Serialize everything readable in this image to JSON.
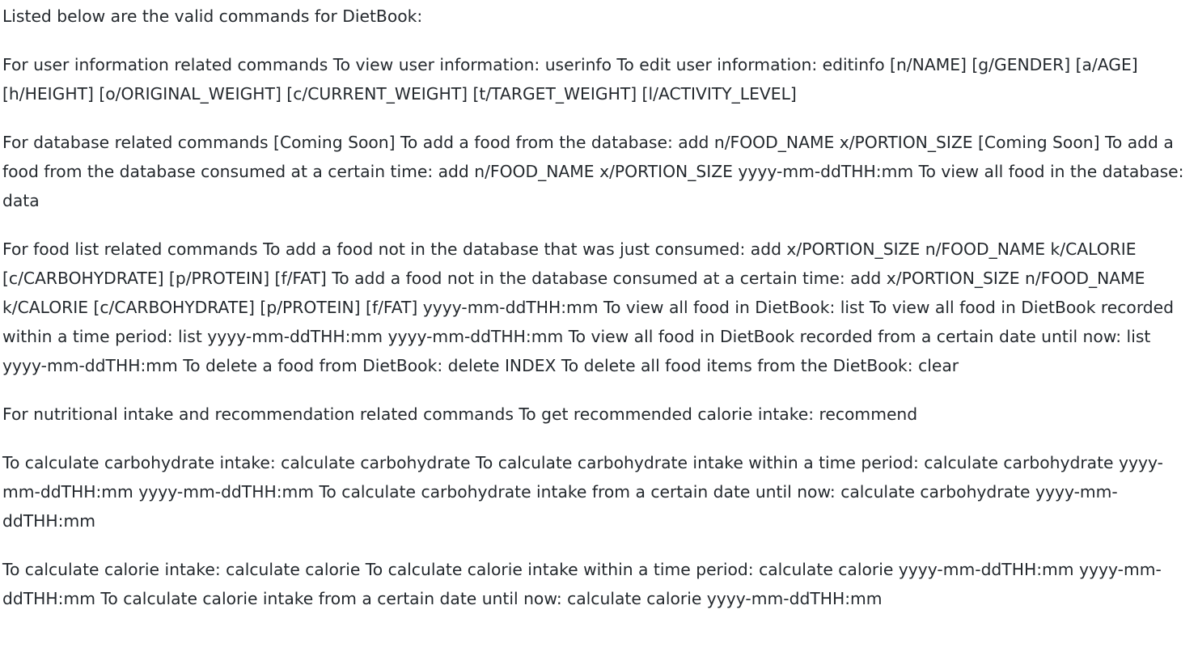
{
  "paragraphs": [
    "Listed below are the valid commands for DietBook:",
    "For user information related commands To view user information: userinfo To edit user information: editinfo [n/NAME] [g/GENDER] [a/AGE] [h/HEIGHT] [o/ORIGINAL_WEIGHT] [c/CURRENT_WEIGHT] [t/TARGET_WEIGHT] [l/ACTIVITY_LEVEL]",
    "For database related commands [Coming Soon] To add a food from the database: add n/FOOD_NAME x/PORTION_SIZE [Coming Soon] To add a food from the database consumed at a certain time: add n/FOOD_NAME x/PORTION_SIZE yyyy-mm-ddTHH:mm To view all food in the database: data",
    "For food list related commands To add a food not in the database that was just consumed: add x/PORTION_SIZE n/FOOD_NAME k/CALORIE [c/CARBOHYDRATE] [p/PROTEIN] [f/FAT] To add a food not in the database consumed at a certain time: add x/PORTION_SIZE n/FOOD_NAME k/CALORIE [c/CARBOHYDRATE] [p/PROTEIN] [f/FAT] yyyy-mm-ddTHH:mm To view all food in DietBook: list To view all food in DietBook recorded within a time period: list yyyy-mm-ddTHH:mm yyyy-mm-ddTHH:mm To view all food in DietBook recorded from a certain date until now: list yyyy-mm-ddTHH:mm To delete a food from DietBook: delete INDEX To delete all food items from the DietBook: clear",
    "For nutritional intake and recommendation related commands To get recommended calorie intake: recommend",
    "To calculate carbohydrate intake: calculate carbohydrate To calculate carbohydrate intake within a time period: calculate carbohydrate yyyy-mm-ddTHH:mm yyyy-mm-ddTHH:mm To calculate carbohydrate intake from a certain date until now: calculate carbohydrate yyyy-mm-ddTHH:mm",
    "To calculate calorie intake: calculate calorie To calculate calorie intake within a time period: calculate calorie yyyy-mm-ddTHH:mm yyyy-mm-ddTHH:mm To calculate calorie intake from a certain date until now: calculate calorie yyyy-mm-ddTHH:mm"
  ]
}
